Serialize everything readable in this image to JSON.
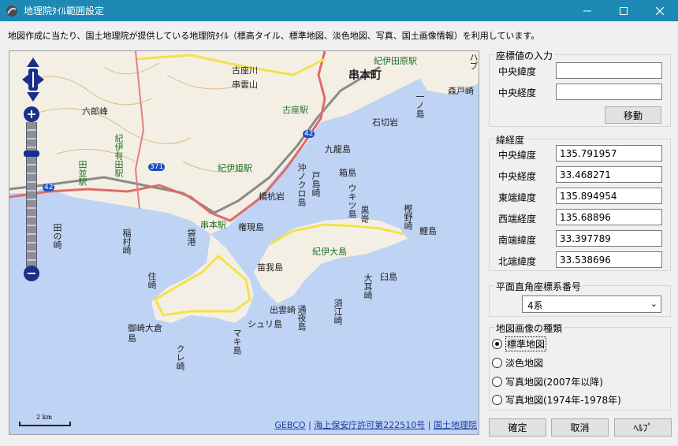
{
  "window": {
    "title": "地理院ﾀｲﾙ範囲設定"
  },
  "description": "地図作成に当たり、国土地理院が提供している地理院ﾀｲﾙ（標高タイル、標準地図、淡色地図、写真、国土画像情報）を利用しています。",
  "map": {
    "labels": {
      "kushimoto": "串本町",
      "kii_tahara": "紀伊田原駅",
      "morito": "森戸崎",
      "koza": "古座駅",
      "kozagawa": "古座川",
      "shimokozagawa": "串雲山",
      "ichinoshima": "一ノ島",
      "ishikiriiwa": "石切岩",
      "kunishima": "九龍島",
      "hakoshima": "箱島",
      "rokurou": "六郎峰",
      "kiiarita": "紀伊有田駅",
      "taname": "田並駅",
      "kiihime": "紀伊姫駅",
      "hashikui": "橋杭岩",
      "okinokuroshima": "沖ノクロ島",
      "tokarishima": "戸島崎",
      "ukitsu": "ウキツ島",
      "kurosaki": "黒嵜",
      "kashino": "樫野崎",
      "koishima": "鯉島",
      "gongen": "権現島",
      "kushimotoeki": "串本駅",
      "tanosaki": "田の崎",
      "inamura": "稲村崎",
      "sabaura": "袋港",
      "kiioshima": "紀伊大島",
      "nakagami": "苗我島",
      "usushima": "臼島",
      "oomimi": "大耳崎",
      "sumi": "住崎",
      "izumo": "出雲崎",
      "kayokawa": "通夜島",
      "suezaki": "須江崎",
      "shurijima": "シュリ島",
      "makishima": "マキ島",
      "ookurashima": "御崎大倉島",
      "kuresaki": "クレ崎",
      "route42": "42",
      "route42b": "42",
      "route371": "371",
      "oshima_tip": "ハブ"
    },
    "scale_label": "2 km",
    "attribution": {
      "gebco": "GEBCO",
      "sep1": "|",
      "permit": "海上保安庁許可第222510号",
      "sep2": "|",
      "gsi": "国土地理院"
    }
  },
  "coord_input": {
    "legend": "座標値の入力",
    "lat_label": "中央緯度",
    "lon_label": "中央経度",
    "lat_value": "",
    "lon_value": "",
    "move_button": "移動"
  },
  "latlon": {
    "legend": "緯経度",
    "rows": [
      {
        "label": "中央緯度",
        "value": "135.791957"
      },
      {
        "label": "中央経度",
        "value": "33.468271"
      },
      {
        "label": "東端緯度",
        "value": "135.894954"
      },
      {
        "label": "西端経度",
        "value": "135.68896"
      },
      {
        "label": "南端緯度",
        "value": "33.397789"
      },
      {
        "label": "北端緯度",
        "value": "33.538696"
      }
    ]
  },
  "plane": {
    "legend": "平面直角座標系番号",
    "selected": "4系"
  },
  "image_type": {
    "legend": "地図画像の種類",
    "options": [
      {
        "label": "標準地図",
        "selected": true
      },
      {
        "label": "淡色地図",
        "selected": false
      },
      {
        "label": "写真地図(2007年以降)",
        "selected": false
      },
      {
        "label": "写真地図(1974年-1978年)",
        "selected": false
      }
    ]
  },
  "buttons": {
    "ok": "確定",
    "cancel": "取消",
    "help": "ﾍﾙﾌﾟ"
  },
  "colors": {
    "titlebar": "#1c8ab5",
    "sea": "#bfd3f4",
    "land": "#f4efe4",
    "road": "#f3e14a",
    "nav": "#1b2f8a"
  }
}
